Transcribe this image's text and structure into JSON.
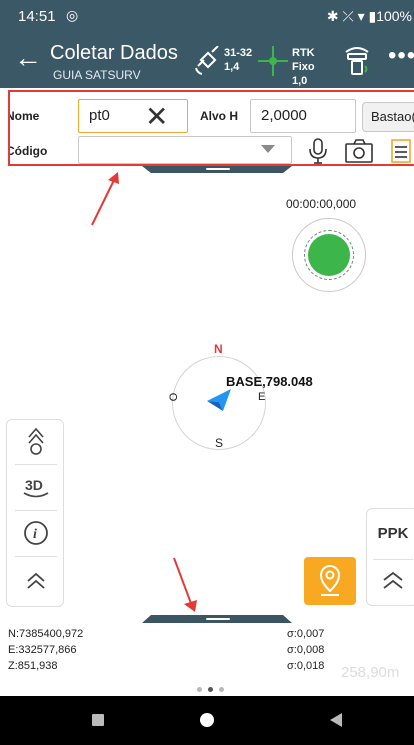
{
  "status_bar": {
    "time": "14:51",
    "record_glyph": "◎",
    "right_icons": "✱ ⤫ ▾ ▮100%"
  },
  "toolbar": {
    "title": "Coletar Dados",
    "subtitle": "GUIA SATSURV",
    "satellites_line1": "31-32",
    "satellites_line2": "1,4",
    "rtk_line1": "RTK Fixo",
    "rtk_line2": "1,0",
    "more_glyph": "•••"
  },
  "form": {
    "name_label": "Nome",
    "name_value": "pt0",
    "antenna_label": "Alvo H",
    "antenna_value": "2,0000",
    "pole_button": "Bastao(P",
    "code_label": "Código",
    "code_value": ""
  },
  "map": {
    "timer": "00:00:00,000",
    "compass": {
      "n": "N",
      "s": "S",
      "o": "O",
      "e": "E"
    },
    "base_label": "BASE,798.048",
    "ppk_label": "PPK"
  },
  "coordinates": {
    "north": "N:7385400,972",
    "east": "E:332577,866",
    "z": "Z:851,938",
    "sigma_n": "σ:0,007",
    "sigma_e": "σ:0,008",
    "sigma_z": "σ:0,018",
    "faded_value": "258,90m"
  },
  "colors": {
    "header": "#3b5866",
    "highlight_border": "#e53935",
    "record_green": "#3cb54a",
    "marker_orange": "#f8a821"
  }
}
